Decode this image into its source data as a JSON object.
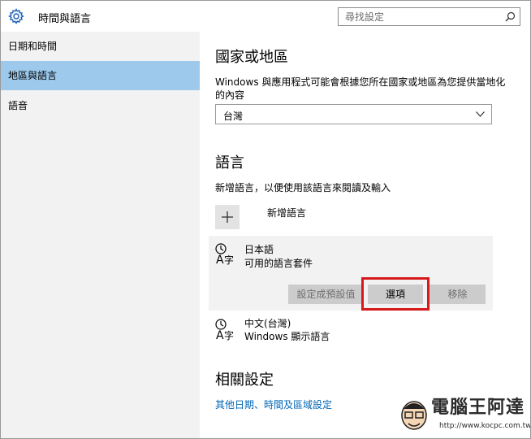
{
  "header": {
    "title": "時間與語言",
    "search_placeholder": "尋找設定"
  },
  "sidebar": {
    "items": [
      {
        "label": "日期和時間",
        "active": false
      },
      {
        "label": "地區與語言",
        "active": true
      },
      {
        "label": "語音",
        "active": false
      }
    ]
  },
  "main": {
    "region_heading": "國家或地區",
    "region_desc_line1": "Windows 與應用程式可能會根據您所在國家或地區為您提供當地化",
    "region_desc_line2": "的內容",
    "region_selected": "台灣",
    "language_heading": "語言",
    "language_desc": "新增語言，以便使用該語言來閱讀及輸入",
    "add_language_label": "新增語言",
    "languages": [
      {
        "name": "日本語",
        "status": "可用的語言套件"
      },
      {
        "name": "中文(台灣)",
        "status": "Windows 顯示語言"
      }
    ],
    "buttons": {
      "set_default": "設定成預設值",
      "options": "選項",
      "remove": "移除"
    },
    "related_heading": "相關設定",
    "related_link": "其他日期、時間及區域設定"
  },
  "watermark": {
    "name": "電腦王阿達",
    "url": "http://www.kocpc.com.tw"
  },
  "colors": {
    "accent": "#9cc9ec",
    "link": "#0067b8",
    "highlight": "#d7191c"
  }
}
